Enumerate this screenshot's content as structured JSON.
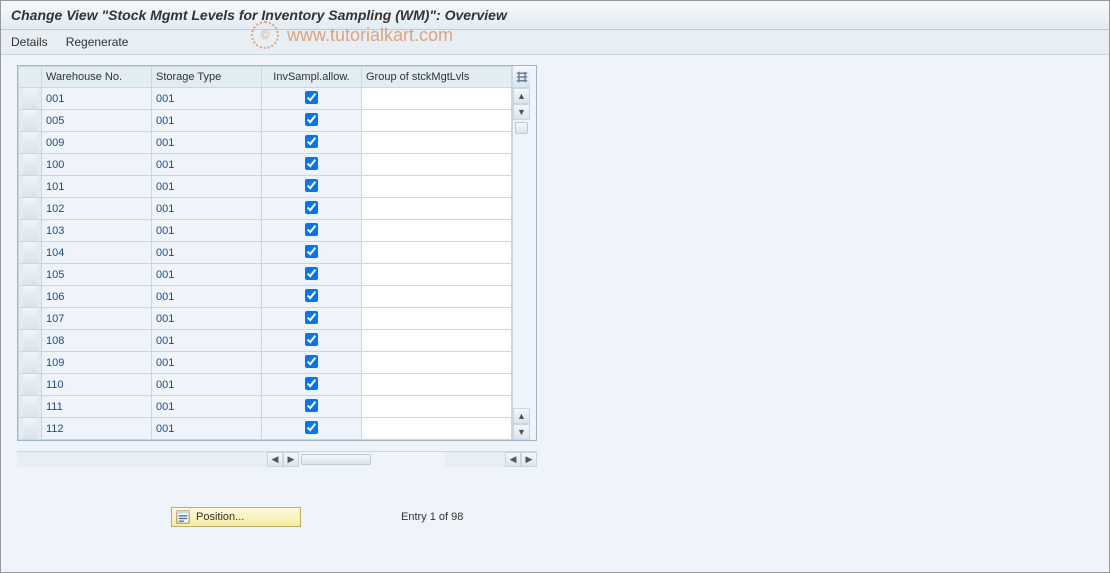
{
  "title": "Change View \"Stock Mgmt Levels for Inventory Sampling (WM)\": Overview",
  "toolbar": {
    "details": "Details",
    "regenerate": "Regenerate"
  },
  "watermark": {
    "copyright": "©",
    "text": "www.tutorialkart.com"
  },
  "columns": {
    "warehouse": "Warehouse No.",
    "storage": "Storage Type",
    "invsampl": "InvSampl.allow.",
    "group": "Group of stckMgtLvls"
  },
  "rows": [
    {
      "wh": "001",
      "st": "001",
      "chk": true,
      "grp": ""
    },
    {
      "wh": "005",
      "st": "001",
      "chk": true,
      "grp": ""
    },
    {
      "wh": "009",
      "st": "001",
      "chk": true,
      "grp": ""
    },
    {
      "wh": "100",
      "st": "001",
      "chk": true,
      "grp": ""
    },
    {
      "wh": "101",
      "st": "001",
      "chk": true,
      "grp": ""
    },
    {
      "wh": "102",
      "st": "001",
      "chk": true,
      "grp": ""
    },
    {
      "wh": "103",
      "st": "001",
      "chk": true,
      "grp": ""
    },
    {
      "wh": "104",
      "st": "001",
      "chk": true,
      "grp": ""
    },
    {
      "wh": "105",
      "st": "001",
      "chk": true,
      "grp": ""
    },
    {
      "wh": "106",
      "st": "001",
      "chk": true,
      "grp": ""
    },
    {
      "wh": "107",
      "st": "001",
      "chk": true,
      "grp": ""
    },
    {
      "wh": "108",
      "st": "001",
      "chk": true,
      "grp": ""
    },
    {
      "wh": "109",
      "st": "001",
      "chk": true,
      "grp": ""
    },
    {
      "wh": "110",
      "st": "001",
      "chk": true,
      "grp": ""
    },
    {
      "wh": "111",
      "st": "001",
      "chk": true,
      "grp": ""
    },
    {
      "wh": "112",
      "st": "001",
      "chk": true,
      "grp": ""
    }
  ],
  "footer": {
    "position_label": "Position...",
    "entry_status": "Entry 1 of 98"
  }
}
